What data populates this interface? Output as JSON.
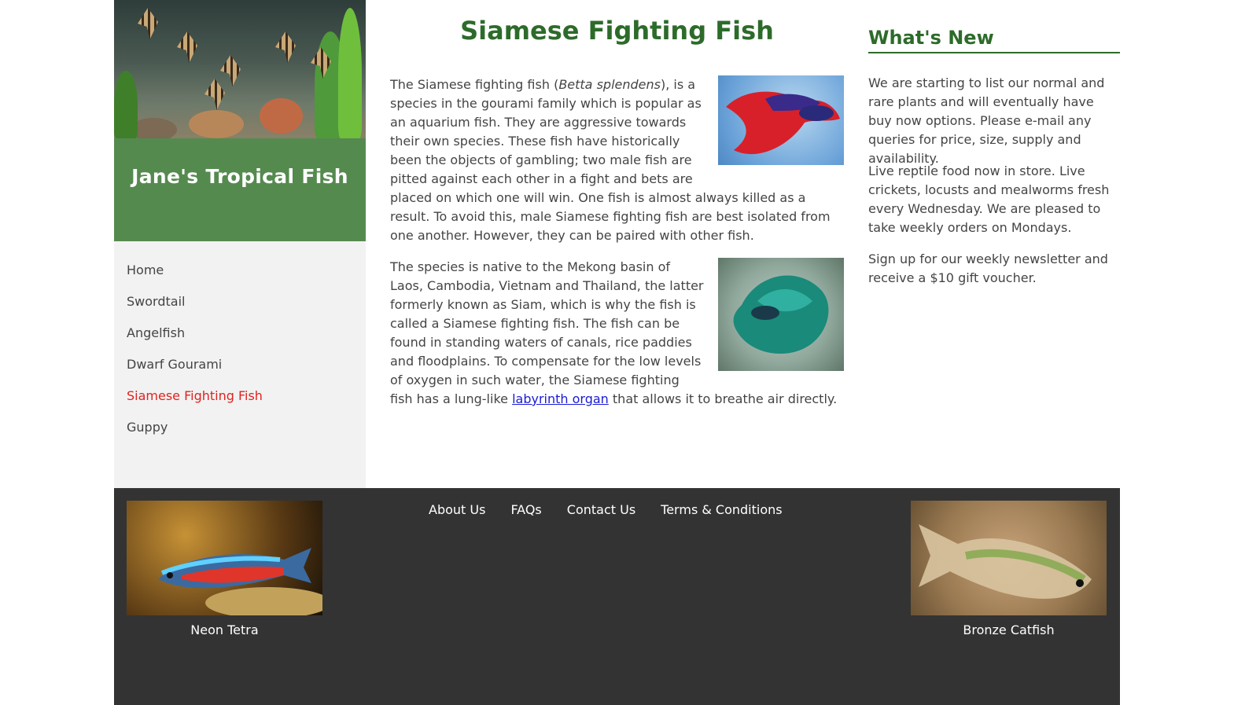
{
  "site": {
    "brand": "Jane's Tropical Fish"
  },
  "nav": {
    "items": [
      {
        "label": "Home"
      },
      {
        "label": "Swordtail"
      },
      {
        "label": "Angelfish"
      },
      {
        "label": "Dwarf Gourami"
      },
      {
        "label": "Siamese Fighting Fish"
      },
      {
        "label": "Guppy"
      }
    ],
    "active": "Siamese Fighting Fish"
  },
  "main": {
    "title": "Siamese Fighting Fish",
    "p1_before": "The Siamese fighting fish (",
    "p1_italic": "Betta splendens",
    "p1_after": "), is a species in the gourami family which is popular as an aquarium fish. They are aggressive towards their own species. These fish have historically been the objects of gambling; two male fish are pitted against each other in a fight and bets are placed on which one will win. One fish is almost always killed as a result. To avoid this, male Siamese fighting fish are best isolated from one another. However, they can be paired with other fish.",
    "p2_before": "The species is native to the Mekong basin of Laos, Cambodia, Vietnam and Thailand, the latter formerly known as Siam, which is why the fish is called a Siamese fighting fish. The fish can be found in standing waters of canals, rice paddies and floodplains. To compensate for the low levels of oxygen in such water, the Siamese fighting fish has a lung-like ",
    "p2_link": "labyrinth organ",
    "p2_after": " that allows it to breathe air directly."
  },
  "news": {
    "title": "What's New",
    "items": [
      "We are starting to list our normal and rare plants and will eventually have buy now options. Please e-mail any queries for price, size, supply and availability.",
      "Live reptile food now in store. Live crickets, locusts and mealworms fresh every Wednesday. We are pleased to take weekly orders on Mondays.",
      "Sign up for our weekly newsletter and receive a $10 gift voucher."
    ]
  },
  "footer": {
    "links": [
      "About Us",
      "FAQs",
      "Contact Us",
      "Terms & Conditions"
    ],
    "left_caption": "Neon Tetra",
    "right_caption": "Bronze Catfish"
  },
  "colors": {
    "brand_green": "#558a4f",
    "heading_green": "#2d6b2a",
    "active_nav": "#e0231f",
    "footer_bg": "#333333",
    "sidebar_bg": "#f2f2f2"
  }
}
